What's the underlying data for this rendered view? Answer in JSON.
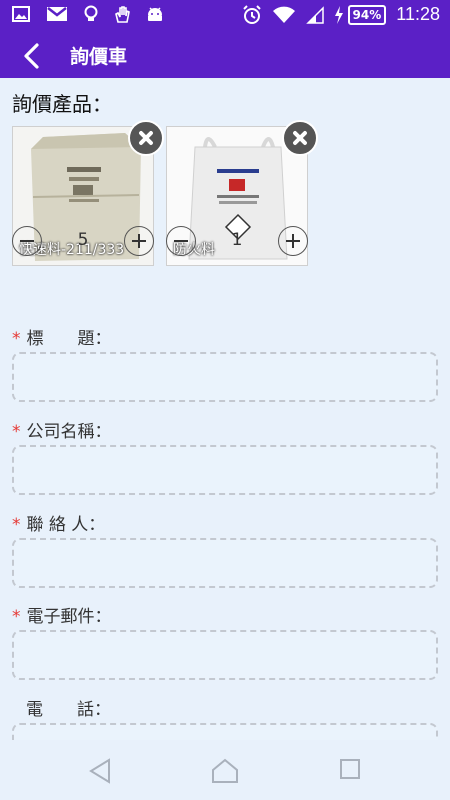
{
  "status_bar": {
    "left_icons": [
      "image-icon",
      "gmail-icon",
      "bulb-icon",
      "hand-icon",
      "android-icon"
    ],
    "battery": "94%",
    "time": "11:28"
  },
  "app_bar": {
    "title": "詢價車"
  },
  "section": {
    "products_label": "詢價產品："
  },
  "products": [
    {
      "name": "快速料-211/333",
      "quantity": "5"
    },
    {
      "name": "防火料",
      "quantity": "1"
    }
  ],
  "form": {
    "fields": [
      {
        "label": "標　　題：",
        "required": true,
        "value": ""
      },
      {
        "label": "公司名稱：",
        "required": true,
        "value": ""
      },
      {
        "label": "聯 絡 人：",
        "required": true,
        "value": ""
      },
      {
        "label": "電子郵件：",
        "required": true,
        "value": ""
      },
      {
        "label": "電　　話：",
        "required": false,
        "value": ""
      }
    ],
    "required_mark": "*"
  },
  "colors": {
    "accent": "#5b20c6",
    "background": "#e8f1fb",
    "required": "#e53935"
  }
}
